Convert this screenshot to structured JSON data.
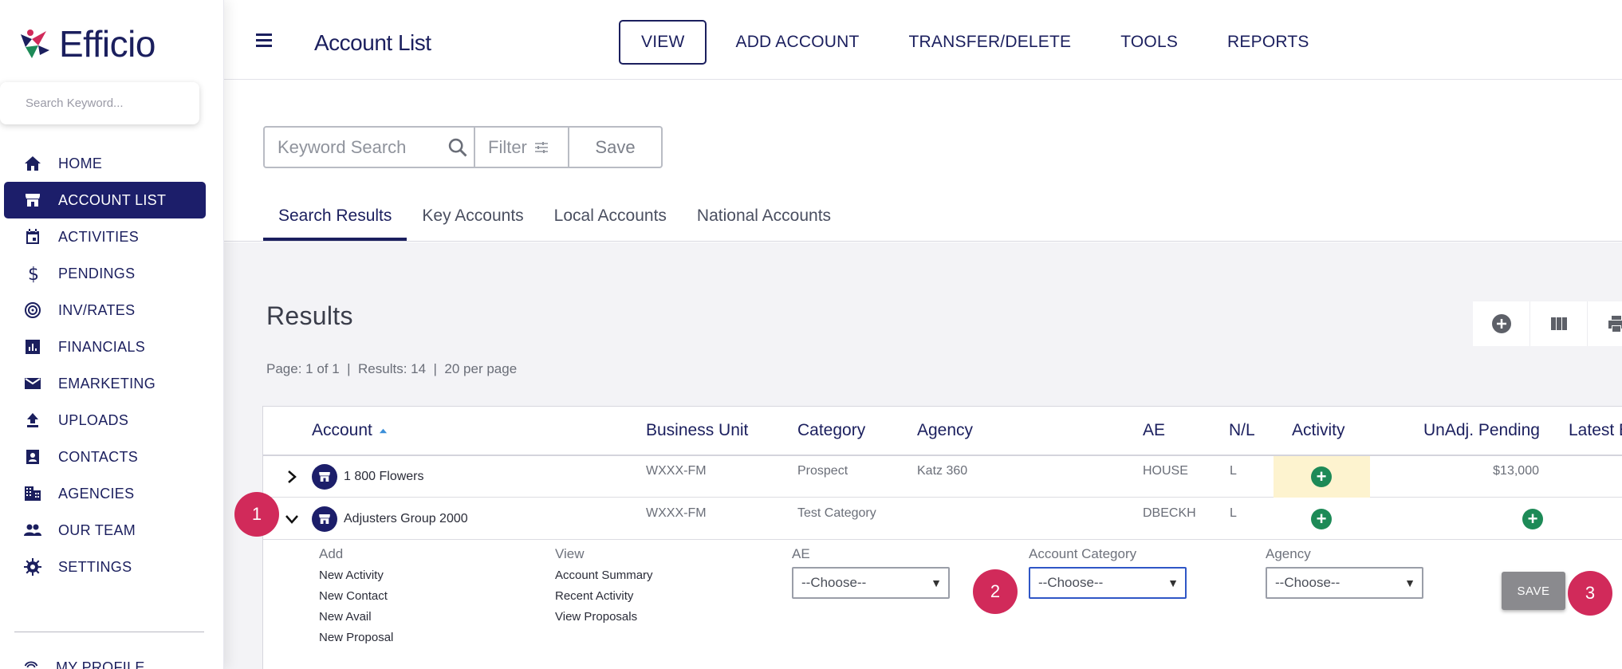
{
  "brand": {
    "name": "Efficio"
  },
  "sidebar": {
    "search_placeholder": "Search Keyword...",
    "items": [
      {
        "label": "HOME",
        "icon": "home-icon"
      },
      {
        "label": "ACCOUNT LIST",
        "icon": "store-icon",
        "active": true
      },
      {
        "label": "ACTIVITIES",
        "icon": "calendar-icon"
      },
      {
        "label": "PENDINGS",
        "icon": "dollar-icon"
      },
      {
        "label": "INV/RATES",
        "icon": "target-icon"
      },
      {
        "label": "FINANCIALS",
        "icon": "bar-chart-icon"
      },
      {
        "label": "EMARKETING",
        "icon": "mail-icon"
      },
      {
        "label": "UPLOADS",
        "icon": "upload-icon"
      },
      {
        "label": "CONTACTS",
        "icon": "contact-card-icon"
      },
      {
        "label": "AGENCIES",
        "icon": "building-icon"
      },
      {
        "label": "OUR TEAM",
        "icon": "people-icon"
      },
      {
        "label": "SETTINGS",
        "icon": "gear-icon"
      }
    ],
    "profile_label": "MY PROFILE"
  },
  "header": {
    "title": "Account List",
    "nav": [
      "VIEW",
      "ADD ACCOUNT",
      "TRANSFER/DELETE",
      "TOOLS",
      "REPORTS"
    ]
  },
  "search": {
    "keyword_placeholder": "Keyword Search",
    "filter_label": "Filter",
    "save_label": "Save"
  },
  "tabs": [
    "Search Results",
    "Key Accounts",
    "Local Accounts",
    "National Accounts"
  ],
  "results": {
    "title": "Results",
    "page": "Page: 1 of 1",
    "count": "Results: 14",
    "per_page": "20 per page"
  },
  "table": {
    "headers": [
      "Account",
      "Business Unit",
      "Category",
      "Agency",
      "AE",
      "N/L",
      "Activity",
      "UnAdj. Pending",
      "Latest B"
    ],
    "rows": [
      {
        "account": "1 800 Flowers",
        "business_unit": "WXXX-FM",
        "category": "Prospect",
        "agency": "Katz 360",
        "ae": "HOUSE",
        "nl": "L",
        "pending": "$13,000"
      },
      {
        "account": "Adjusters Group 2000",
        "business_unit": "WXXX-FM",
        "category": "Test Category",
        "agency": "",
        "ae": "DBECKH",
        "nl": "L",
        "pending": ""
      }
    ]
  },
  "expanded": {
    "add_label": "Add",
    "add_links": [
      "New Activity",
      "New Contact",
      "New Avail",
      "New Proposal"
    ],
    "view_label": "View",
    "view_links": [
      "Account Summary",
      "Recent Activity",
      "View Proposals"
    ],
    "ae_label": "AE",
    "category_label": "Account Category",
    "agency_label": "Agency",
    "choose": "--Choose--",
    "save_label": "SAVE"
  },
  "steps": [
    "1",
    "2",
    "3"
  ],
  "colors": {
    "navy": "#1b1f5e",
    "active_nav": "#1c1e6a",
    "plus_green": "#1d8a57",
    "step_pink": "#d12a5a",
    "activity_highlight": "#fdf3cf"
  }
}
